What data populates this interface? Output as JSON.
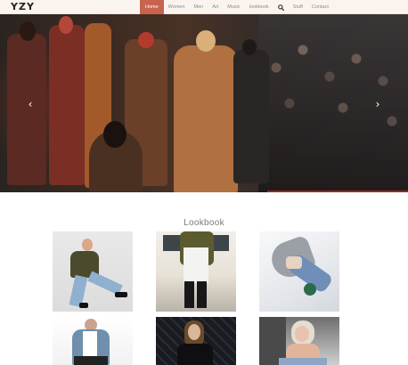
{
  "brand": {
    "logo": "YZY"
  },
  "nav": {
    "items": [
      {
        "label": "Home",
        "active": true
      },
      {
        "label": "Women",
        "active": false
      },
      {
        "label": "Men",
        "active": false
      },
      {
        "label": "Art",
        "active": false
      },
      {
        "label": "Music",
        "active": false
      },
      {
        "label": "lookbook",
        "active": false
      }
    ],
    "search_icon": "search-icon",
    "items_after_search": [
      {
        "label": "Stuff"
      },
      {
        "label": "Contact"
      }
    ],
    "active_color": "#c9634f"
  },
  "hero": {
    "prev_icon": "chevron-left-icon",
    "next_icon": "chevron-right-icon",
    "prev_glyph": "‹",
    "next_glyph": "›"
  },
  "lookbook": {
    "title": "Lookbook",
    "items": [
      {
        "image": "man-seated-olive-jacket-photo"
      },
      {
        "image": "person-olive-jacket-ripped-jeans-photo"
      },
      {
        "image": "woman-on-bed-jeans-mug-photo"
      },
      {
        "image": "man-denim-jacket-photo"
      },
      {
        "image": "woman-dark-jacket-fence-photo"
      },
      {
        "image": "woman-blonde-pink-top-photo"
      }
    ]
  }
}
